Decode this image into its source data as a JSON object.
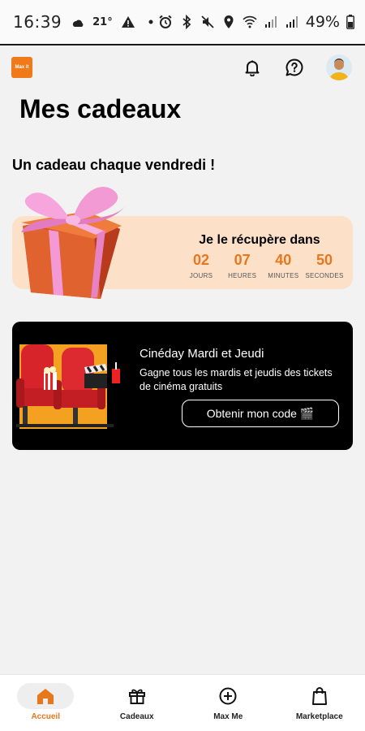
{
  "status_bar": {
    "time": "16:39",
    "temperature": "21°",
    "battery": "49%",
    "icons": [
      "weather-icon",
      "warning-icon",
      "dot-icon",
      "alarm-icon",
      "bluetooth-icon",
      "mute-icon",
      "location-icon",
      "wifi-icon",
      "signal-icon",
      "signal-icon",
      "battery-icon"
    ]
  },
  "header": {
    "logo_text": "Max it",
    "icons": [
      "bell-icon",
      "help-icon",
      "avatar"
    ]
  },
  "page": {
    "title": "Mes cadeaux",
    "section_title": "Un cadeau chaque vendredi !"
  },
  "countdown": {
    "label": "Je le récupère dans",
    "units": [
      {
        "value": "02",
        "label": "JOURS"
      },
      {
        "value": "07",
        "label": "HEURES"
      },
      {
        "value": "40",
        "label": "MINUTES"
      },
      {
        "value": "50",
        "label": "SECONDES"
      }
    ],
    "accent_color": "#e8771c",
    "card_color": "#fde0c8"
  },
  "promo": {
    "title": "Cinéday Mardi et Jeudi",
    "description": "Gagne tous les mardis et jeudis des tickets de cinéma gratuits",
    "button_label": "Obtenir mon code 🎬"
  },
  "bottom_nav": {
    "items": [
      {
        "label": "Accueil",
        "icon": "home-icon",
        "active": true
      },
      {
        "label": "Cadeaux",
        "icon": "gift-icon",
        "active": false
      },
      {
        "label": "Max Me",
        "icon": "plus-circle-icon",
        "active": false
      },
      {
        "label": "Marketplace",
        "icon": "shopping-bag-icon",
        "active": false
      }
    ],
    "active_color": "#e8771c"
  }
}
